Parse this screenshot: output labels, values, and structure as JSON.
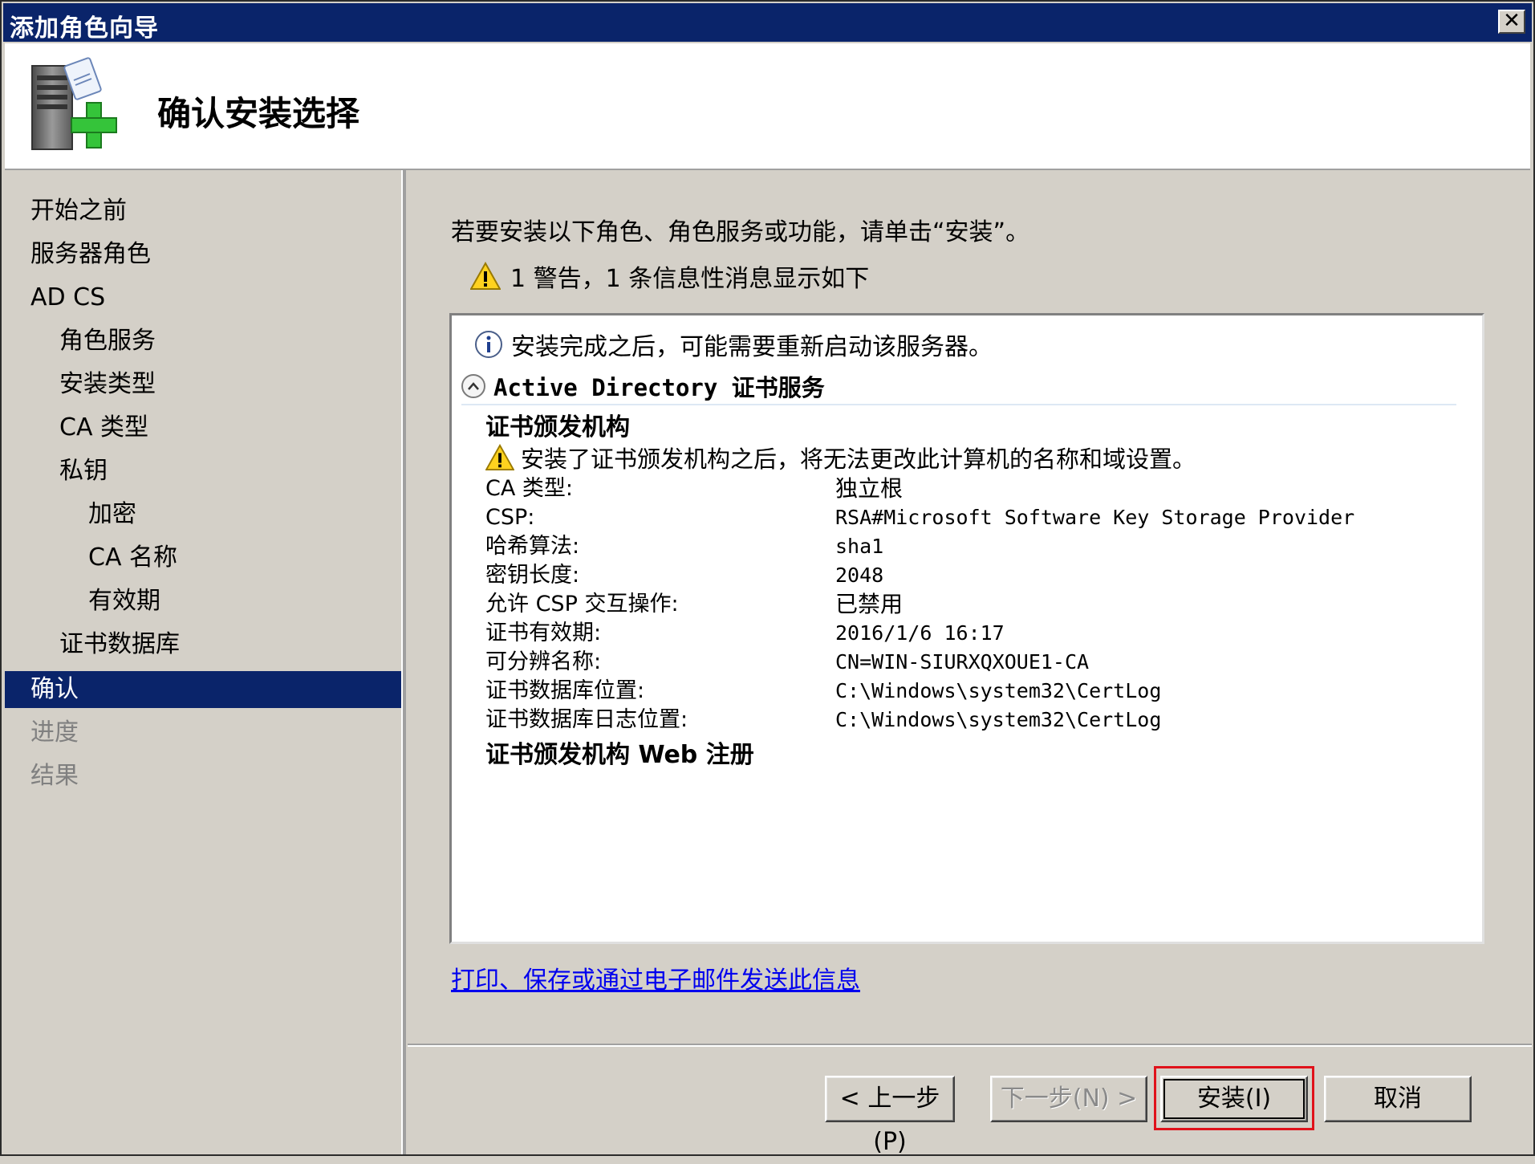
{
  "window": {
    "title": "添加角色向导",
    "close_glyph": "✕"
  },
  "header": {
    "page_title": "确认安装选择",
    "icon": "server-add-icon"
  },
  "sidebar": {
    "items": [
      {
        "label": "开始之前",
        "level": 0,
        "state": "normal"
      },
      {
        "label": "服务器角色",
        "level": 0,
        "state": "normal"
      },
      {
        "label": "AD CS",
        "level": 0,
        "state": "normal"
      },
      {
        "label": "角色服务",
        "level": 1,
        "state": "normal"
      },
      {
        "label": "安装类型",
        "level": 1,
        "state": "normal"
      },
      {
        "label": "CA 类型",
        "level": 1,
        "state": "normal"
      },
      {
        "label": "私钥",
        "level": 1,
        "state": "normal"
      },
      {
        "label": "加密",
        "level": 2,
        "state": "normal"
      },
      {
        "label": "CA 名称",
        "level": 2,
        "state": "normal"
      },
      {
        "label": "有效期",
        "level": 2,
        "state": "normal"
      },
      {
        "label": "证书数据库",
        "level": 1,
        "state": "normal"
      },
      {
        "label": "确认",
        "level": 0,
        "state": "selected"
      },
      {
        "label": "进度",
        "level": 0,
        "state": "disabled"
      },
      {
        "label": "结果",
        "level": 0,
        "state": "disabled"
      }
    ]
  },
  "main": {
    "instruction": "若要安装以下角色、角色服务或功能，请单击“安装”。",
    "warning_summary": "1 警告，1 条信息性消息显示如下",
    "details": {
      "info_message": "安装完成之后，可能需要重新启动该服务器。",
      "section_title": "Active Directory 证书服务",
      "ca_heading": "证书颁发机构",
      "ca_warning": "安装了证书颁发机构之后，将无法更改此计算机的名称和域设置。",
      "properties": [
        {
          "key": "CA 类型:",
          "value": "独立根"
        },
        {
          "key": "CSP:",
          "value": "RSA#Microsoft Software Key Storage Provider"
        },
        {
          "key": "哈希算法:",
          "value": "sha1"
        },
        {
          "key": "密钥长度:",
          "value": "2048"
        },
        {
          "key": "允许 CSP 交互操作:",
          "value": "已禁用"
        },
        {
          "key": "证书有效期:",
          "value": "2016/1/6 16:17"
        },
        {
          "key": "可分辨名称:",
          "value": "CN=WIN-SIURXQXOUE1-CA"
        },
        {
          "key": "证书数据库位置:",
          "value": "C:\\Windows\\system32\\CertLog"
        },
        {
          "key": "证书数据库日志位置:",
          "value": "C:\\Windows\\system32\\CertLog"
        }
      ],
      "web_enrollment_heading": "证书颁发机构 Web 注册"
    },
    "link_text": "打印、保存或通过电子邮件发送此信息"
  },
  "buttons": {
    "back": "< 上一步(P)",
    "next": "下一步(N) >",
    "install": "安装(I)",
    "cancel": "取消"
  },
  "colors": {
    "title_bar": "#0a246a",
    "selected_nav": "#0a246a",
    "dialog_face": "#d4d0c8",
    "highlight_frame": "#e0121b",
    "link": "#0000ee"
  }
}
